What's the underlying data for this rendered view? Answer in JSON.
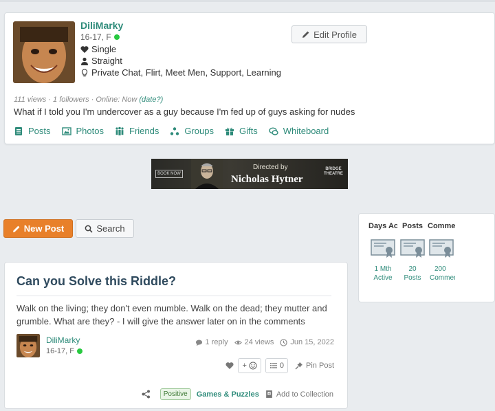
{
  "profile": {
    "name": "DiliMarky",
    "age_gender": "16-17, F",
    "status": "Single",
    "orientation": "Straight",
    "interests": "Private Chat, Flirt, Meet Men, Support, Learning",
    "edit_label": "Edit Profile",
    "stats_text": "111 views · 1 followers · Online: Now",
    "date_link": "(date?)",
    "bio": "What if I told you I'm undercover as a guy because I'm fed up of guys asking for nudes",
    "nav": [
      {
        "label": "Posts",
        "icon": "posts-icon"
      },
      {
        "label": "Photos",
        "icon": "photos-icon"
      },
      {
        "label": "Friends",
        "icon": "friends-icon"
      },
      {
        "label": "Groups",
        "icon": "groups-icon"
      },
      {
        "label": "Gifts",
        "icon": "gift-icon"
      },
      {
        "label": "Whiteboard",
        "icon": "whiteboard-icon"
      }
    ]
  },
  "ad": {
    "book_now": "BOOK NOW",
    "subtitle": "Directed by",
    "title": "Nicholas Hytner",
    "logo": "BRIDGE THEATRE"
  },
  "actions": {
    "new_post": "New Post",
    "search": "Search"
  },
  "stats": {
    "columns": [
      {
        "head": "Days Active",
        "line1": "1 Mth",
        "line2": "Active"
      },
      {
        "head": "Posts",
        "line1": "20",
        "line2": "Posts"
      },
      {
        "head": "Comments",
        "line1": "200",
        "line2": "Comments"
      }
    ]
  },
  "post": {
    "title": "Can you Solve this Riddle?",
    "body": "Walk on the living; they don't even mumble. Walk on the dead; they mutter and grumble. What are they? - I will give the answer later on in the comments",
    "author": "DiliMarky",
    "author_age": "16-17, F",
    "replies": "1 reply",
    "views": "24 views",
    "date": "Jun 15, 2022",
    "react_add": "+",
    "list_count": "0",
    "pin_label": "Pin Post",
    "tag": "Positive",
    "category": "Games & Puzzles",
    "collection": "Add to Collection"
  },
  "colors": {
    "accent": "#2e8b7a",
    "orange": "#e8802a",
    "online": "#28c940"
  }
}
